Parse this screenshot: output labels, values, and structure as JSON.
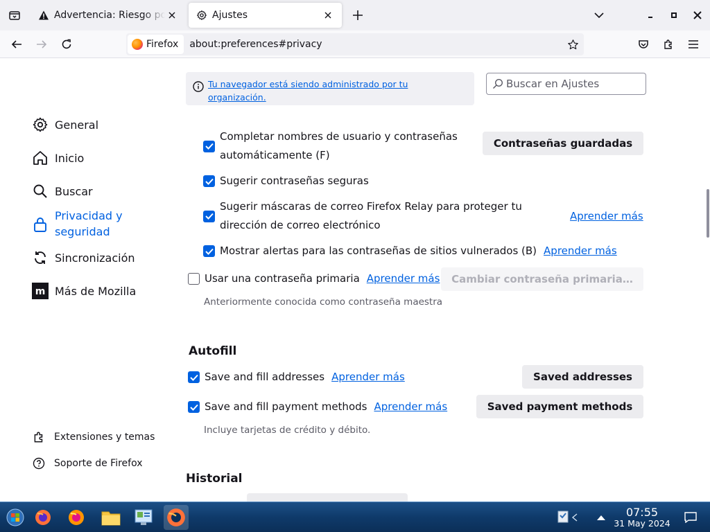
{
  "tabs": [
    {
      "title": "Advertencia: Riesgo potencial de seguridad",
      "active": false,
      "icon": "warning-icon"
    },
    {
      "title": "Ajustes",
      "active": true,
      "icon": "gear-icon"
    }
  ],
  "navbar": {
    "identity_label": "Firefox",
    "url": "about:preferences#privacy"
  },
  "policy": {
    "text": "Tu navegador está siendo administrado por tu organización."
  },
  "search": {
    "placeholder": "Buscar en Ajustes"
  },
  "sidebar": {
    "items": [
      {
        "label": "General",
        "icon": "gear-icon"
      },
      {
        "label": "Inicio",
        "icon": "home-icon"
      },
      {
        "label": "Buscar",
        "icon": "search-icon"
      },
      {
        "label": "Privacidad y seguridad",
        "icon": "lock-icon",
        "selected": true
      },
      {
        "label": "Sincronización",
        "icon": "sync-icon"
      },
      {
        "label": "Más de Mozilla",
        "icon": "mozilla-icon"
      }
    ],
    "footer": [
      {
        "label": "Extensiones y temas",
        "icon": "puzzle-icon"
      },
      {
        "label": "Soporte de Firefox",
        "icon": "help-icon"
      }
    ]
  },
  "passwords": {
    "autofill_label": "Completar nombres de usuario y contraseñas automáticamente (F)",
    "autofill_checked": true,
    "saved_button": "Contraseñas guardadas",
    "suggest_label": "Sugerir contraseñas seguras",
    "suggest_checked": true,
    "relay_label": "Sugerir máscaras de correo Firefox Relay para proteger tu dirección de correo electrónico",
    "relay_checked": true,
    "relay_learn_more": "Aprender más",
    "breach_label": "Mostrar alertas para las contraseñas de sitios vulnerados (B)",
    "breach_checked": true,
    "breach_learn_more": "Aprender más",
    "primary_label": "Usar una contraseña primaria",
    "primary_checked": false,
    "primary_learn_more": "Aprender más",
    "primary_button": "Cambiar contraseña primaria…",
    "primary_note": "Anteriormente conocida como contraseña maestra"
  },
  "autofill": {
    "title": "Autofill",
    "addresses_label": "Save and fill addresses",
    "addresses_checked": true,
    "addresses_learn_more": "Aprender más",
    "addresses_button": "Saved addresses",
    "payments_label": "Save and fill payment methods",
    "payments_checked": true,
    "payments_learn_more": "Aprender más",
    "payments_button": "Saved payment methods",
    "payments_note": "Incluye tarjetas de crédito y débito."
  },
  "history": {
    "title": "Historial"
  },
  "taskbar": {
    "time": "07:55",
    "date": "31 May 2024"
  },
  "colors": {
    "accent": "#0061e0",
    "taskbar": "#0f3a6a"
  }
}
